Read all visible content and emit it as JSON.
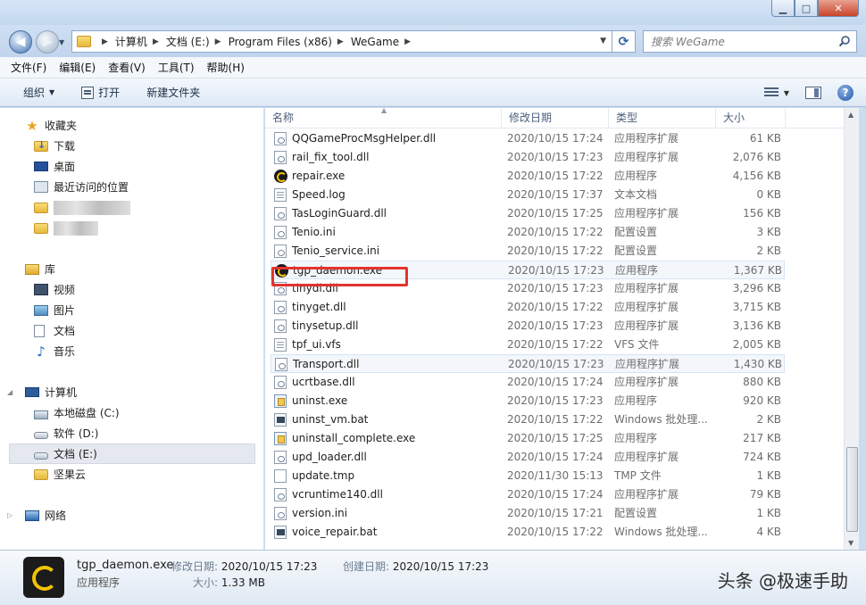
{
  "window_controls": {
    "minimize": "▁",
    "maximize": "□",
    "close": "✕"
  },
  "address": {
    "breadcrumbs": [
      "计算机",
      "文档 (E:)",
      "Program Files (x86)",
      "WeGame"
    ],
    "search_placeholder": "搜索 WeGame"
  },
  "menu": [
    "文件(F)",
    "编辑(E)",
    "查看(V)",
    "工具(T)",
    "帮助(H)"
  ],
  "toolbar": {
    "organize": "组织",
    "open": "打开",
    "new_folder": "新建文件夹",
    "help": "?"
  },
  "nav": {
    "favorites": "收藏夹",
    "downloads": "下载",
    "desktop": "桌面",
    "recent": "最近访问的位置",
    "library": "库",
    "videos": "视频",
    "pictures": "图片",
    "documents": "文档",
    "music": "音乐",
    "computer": "计算机",
    "drive_c": "本地磁盘 (C:)",
    "drive_d": "软件 (D:)",
    "drive_e": "文档 (E:)",
    "jianguoyun": "坚果云",
    "network": "网络"
  },
  "columns": {
    "name": "名称",
    "date": "修改日期",
    "type": "类型",
    "size": "大小"
  },
  "files": [
    {
      "name": "QQGameProcMsgHelper.dll",
      "date": "2020/10/15 17:24",
      "type": "应用程序扩展",
      "size": "61 KB",
      "icon": "dll"
    },
    {
      "name": "rail_fix_tool.dll",
      "date": "2020/10/15 17:23",
      "type": "应用程序扩展",
      "size": "2,076 KB",
      "icon": "dll"
    },
    {
      "name": "repair.exe",
      "date": "2020/10/15 17:22",
      "type": "应用程序",
      "size": "4,156 KB",
      "icon": "wg"
    },
    {
      "name": "Speed.log",
      "date": "2020/10/15 17:37",
      "type": "文本文档",
      "size": "0 KB",
      "icon": "log"
    },
    {
      "name": "TasLoginGuard.dll",
      "date": "2020/10/15 17:25",
      "type": "应用程序扩展",
      "size": "156 KB",
      "icon": "dll"
    },
    {
      "name": "Tenio.ini",
      "date": "2020/10/15 17:22",
      "type": "配置设置",
      "size": "3 KB",
      "icon": "ini"
    },
    {
      "name": "Tenio_service.ini",
      "date": "2020/10/15 17:22",
      "type": "配置设置",
      "size": "2 KB",
      "icon": "ini"
    },
    {
      "name": "tgp_daemon.exe",
      "date": "2020/10/15 17:23",
      "type": "应用程序",
      "size": "1,367 KB",
      "icon": "wg"
    },
    {
      "name": "tinydl.dll",
      "date": "2020/10/15 17:23",
      "type": "应用程序扩展",
      "size": "3,296 KB",
      "icon": "dll"
    },
    {
      "name": "tinyget.dll",
      "date": "2020/10/15 17:22",
      "type": "应用程序扩展",
      "size": "3,715 KB",
      "icon": "dll"
    },
    {
      "name": "tinysetup.dll",
      "date": "2020/10/15 17:23",
      "type": "应用程序扩展",
      "size": "3,136 KB",
      "icon": "dll"
    },
    {
      "name": "tpf_ui.vfs",
      "date": "2020/10/15 17:22",
      "type": "VFS 文件",
      "size": "2,005 KB",
      "icon": "vfs"
    },
    {
      "name": "Transport.dll",
      "date": "2020/10/15 17:23",
      "type": "应用程序扩展",
      "size": "1,430 KB",
      "icon": "dll"
    },
    {
      "name": "ucrtbase.dll",
      "date": "2020/10/15 17:24",
      "type": "应用程序扩展",
      "size": "880 KB",
      "icon": "dll"
    },
    {
      "name": "uninst.exe",
      "date": "2020/10/15 17:23",
      "type": "应用程序",
      "size": "920 KB",
      "icon": "uninst"
    },
    {
      "name": "uninst_vm.bat",
      "date": "2020/10/15 17:22",
      "type": "Windows 批处理...",
      "size": "2 KB",
      "icon": "bat"
    },
    {
      "name": "uninstall_complete.exe",
      "date": "2020/10/15 17:25",
      "type": "应用程序",
      "size": "217 KB",
      "icon": "uninst"
    },
    {
      "name": "upd_loader.dll",
      "date": "2020/10/15 17:24",
      "type": "应用程序扩展",
      "size": "724 KB",
      "icon": "dll"
    },
    {
      "name": "update.tmp",
      "date": "2020/11/30 15:13",
      "type": "TMP 文件",
      "size": "1 KB",
      "icon": "tmp"
    },
    {
      "name": "vcruntime140.dll",
      "date": "2020/10/15 17:24",
      "type": "应用程序扩展",
      "size": "79 KB",
      "icon": "dll"
    },
    {
      "name": "version.ini",
      "date": "2020/10/15 17:21",
      "type": "配置设置",
      "size": "1 KB",
      "icon": "ini"
    },
    {
      "name": "voice_repair.bat",
      "date": "2020/10/15 17:22",
      "type": "Windows 批处理...",
      "size": "4 KB",
      "icon": "bat"
    }
  ],
  "details": {
    "name": "tgp_daemon.exe",
    "type": "应用程序",
    "modified_label": "修改日期:",
    "modified": "2020/10/15 17:23",
    "created_label": "创建日期:",
    "created": "2020/10/15 17:23",
    "size_label": "大小:",
    "size": "1.33 MB"
  },
  "watermark": "头条 @极速手助",
  "colors": {
    "highlight_box": "#e3342f",
    "window_frame": "#c9dcf0"
  }
}
